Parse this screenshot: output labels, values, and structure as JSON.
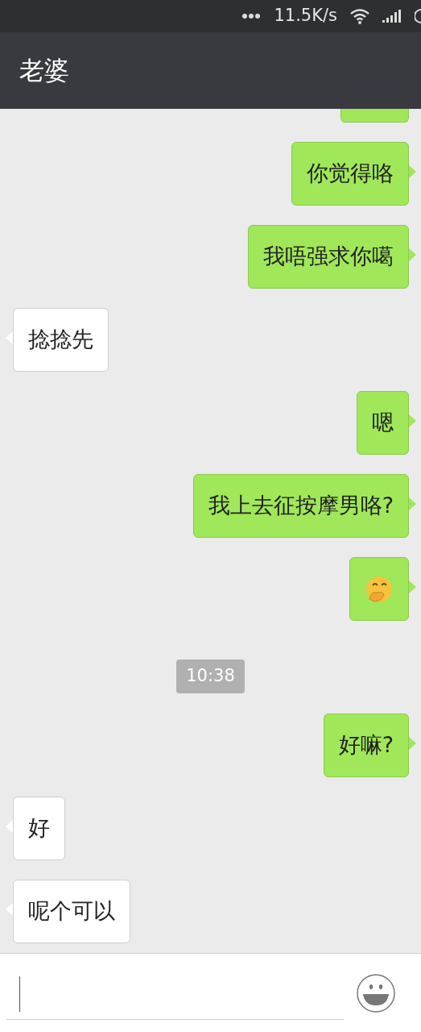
{
  "status_bar": {
    "speed": "11.5K/s"
  },
  "header": {
    "title": "老婆"
  },
  "messages": [
    {
      "outgoing": true,
      "kind": "fragment"
    },
    {
      "outgoing": true,
      "kind": "text",
      "text": "你觉得咯"
    },
    {
      "outgoing": true,
      "kind": "text",
      "text": "我唔强求你噶"
    },
    {
      "outgoing": false,
      "kind": "text",
      "text": "捻捻先"
    },
    {
      "outgoing": true,
      "kind": "text",
      "text": "嗯"
    },
    {
      "outgoing": true,
      "kind": "text",
      "text": "我上去征按摩男咯?"
    },
    {
      "outgoing": true,
      "kind": "emoji"
    },
    {
      "kind": "time",
      "text": "10:38"
    },
    {
      "outgoing": true,
      "kind": "text",
      "text": "好嘛?"
    },
    {
      "outgoing": false,
      "kind": "text",
      "text": "好"
    },
    {
      "outgoing": false,
      "kind": "text",
      "text": "呢个可以"
    }
  ]
}
